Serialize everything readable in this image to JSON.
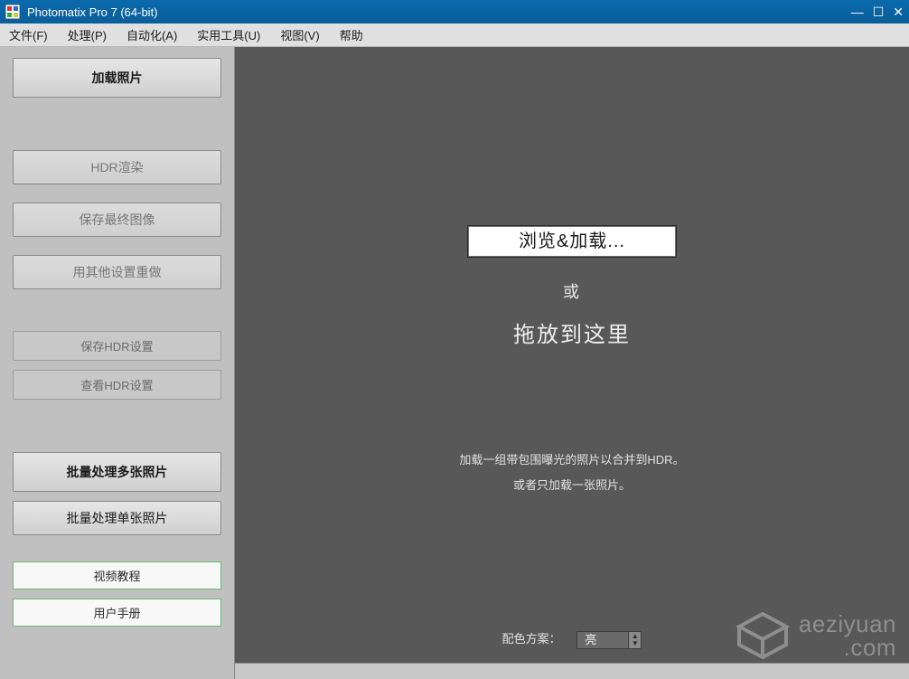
{
  "window": {
    "title": "Photomatix Pro 7  (64-bit)"
  },
  "menu": {
    "file": "文件(F)",
    "process": "处理(P)",
    "automate": "自动化(A)",
    "utilities": "实用工具(U)",
    "view": "视图(V)",
    "help": "帮助"
  },
  "sidebar": {
    "load_photos": "加载照片",
    "hdr_render": "HDR渲染",
    "save_final": "保存最终图像",
    "redo_other": "用其他设置重做",
    "save_hdr_settings": "保存HDR设置",
    "view_hdr_settings": "查看HDR设置",
    "batch_multi": "批量处理多张照片",
    "batch_single": "批量处理单张照片",
    "video_tutorial": "视频教程",
    "user_manual": "用户手册"
  },
  "viewport": {
    "browse_load": "浏览&加载...",
    "or": "或",
    "drop_here": "拖放到这里",
    "hint1": "加载一组带包围曝光的照片以合并到HDR。",
    "hint2": "或者只加载一张照片。",
    "scheme_label": "配色方案：",
    "scheme_value": "亮"
  },
  "watermark": {
    "line1": "aeziyuan",
    "line2": ".com"
  }
}
